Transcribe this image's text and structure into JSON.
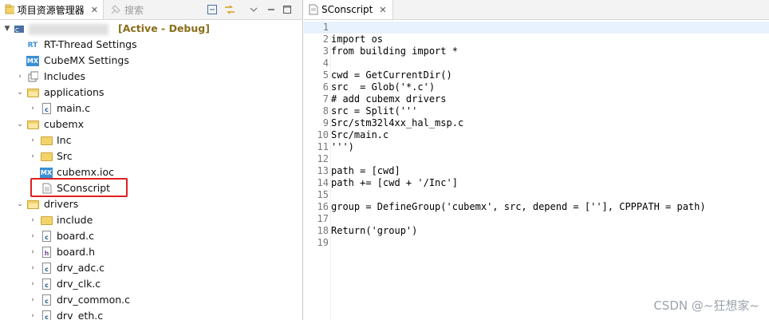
{
  "left_panel": {
    "tab_active": "项目资源管理器",
    "tab_inactive": "搜索"
  },
  "project": {
    "label": "[Active - Debug]"
  },
  "tree": [
    {
      "label": "RT-Thread Settings",
      "icon": "rt-settings-icon"
    },
    {
      "label": "CubeMX Settings",
      "icon": "cubemx-icon"
    },
    {
      "label": "Includes",
      "icon": "includes-icon"
    },
    {
      "label": "applications",
      "icon": "folder-icon"
    },
    {
      "label": "main.c",
      "icon": "c-file-icon"
    },
    {
      "label": "cubemx",
      "icon": "folder-icon"
    },
    {
      "label": "Inc",
      "icon": "folder-icon"
    },
    {
      "label": "Src",
      "icon": "folder-icon"
    },
    {
      "label": "cubemx.ioc",
      "icon": "cubemx-icon"
    },
    {
      "label": "SConscript",
      "icon": "text-file-icon"
    },
    {
      "label": "drivers",
      "icon": "folder-icon"
    },
    {
      "label": "include",
      "icon": "folder-icon"
    },
    {
      "label": "board.c",
      "icon": "c-file-icon"
    },
    {
      "label": "board.h",
      "icon": "h-file-icon"
    },
    {
      "label": "drv_adc.c",
      "icon": "c-file-icon"
    },
    {
      "label": "drv_clk.c",
      "icon": "c-file-icon"
    },
    {
      "label": "drv_common.c",
      "icon": "c-file-icon"
    },
    {
      "label": "drv_eth.c",
      "icon": "c-file-icon"
    }
  ],
  "editor": {
    "tab_label": "SConscript",
    "lines": [
      {
        "n": "1",
        "text": ""
      },
      {
        "n": "2",
        "text": "import os"
      },
      {
        "n": "3",
        "text": "from building import *"
      },
      {
        "n": "4",
        "text": ""
      },
      {
        "n": "5",
        "text": "cwd = GetCurrentDir()"
      },
      {
        "n": "6",
        "text": "src  = Glob('*.c')"
      },
      {
        "n": "7",
        "text": "# add cubemx drivers"
      },
      {
        "n": "8",
        "text": "src = Split('''"
      },
      {
        "n": "9",
        "text": "Src/stm32l4xx_hal_msp.c"
      },
      {
        "n": "10",
        "text": "Src/main.c"
      },
      {
        "n": "11",
        "text": "''')"
      },
      {
        "n": "12",
        "text": ""
      },
      {
        "n": "13",
        "text": "path = [cwd]"
      },
      {
        "n": "14",
        "text": "path += [cwd + '/Inc']"
      },
      {
        "n": "15",
        "text": ""
      },
      {
        "n": "16",
        "text": "group = DefineGroup('cubemx', src, depend = [''], CPPPATH = path)"
      },
      {
        "n": "17",
        "text": ""
      },
      {
        "n": "18",
        "text": "Return('group')"
      },
      {
        "n": "19",
        "text": ""
      }
    ]
  },
  "watermark": "CSDN @~狂想家~",
  "colors": {
    "highlight_border": "#e02020",
    "current_line": "#e8f2fe",
    "project_label": "#8a6d1a"
  }
}
